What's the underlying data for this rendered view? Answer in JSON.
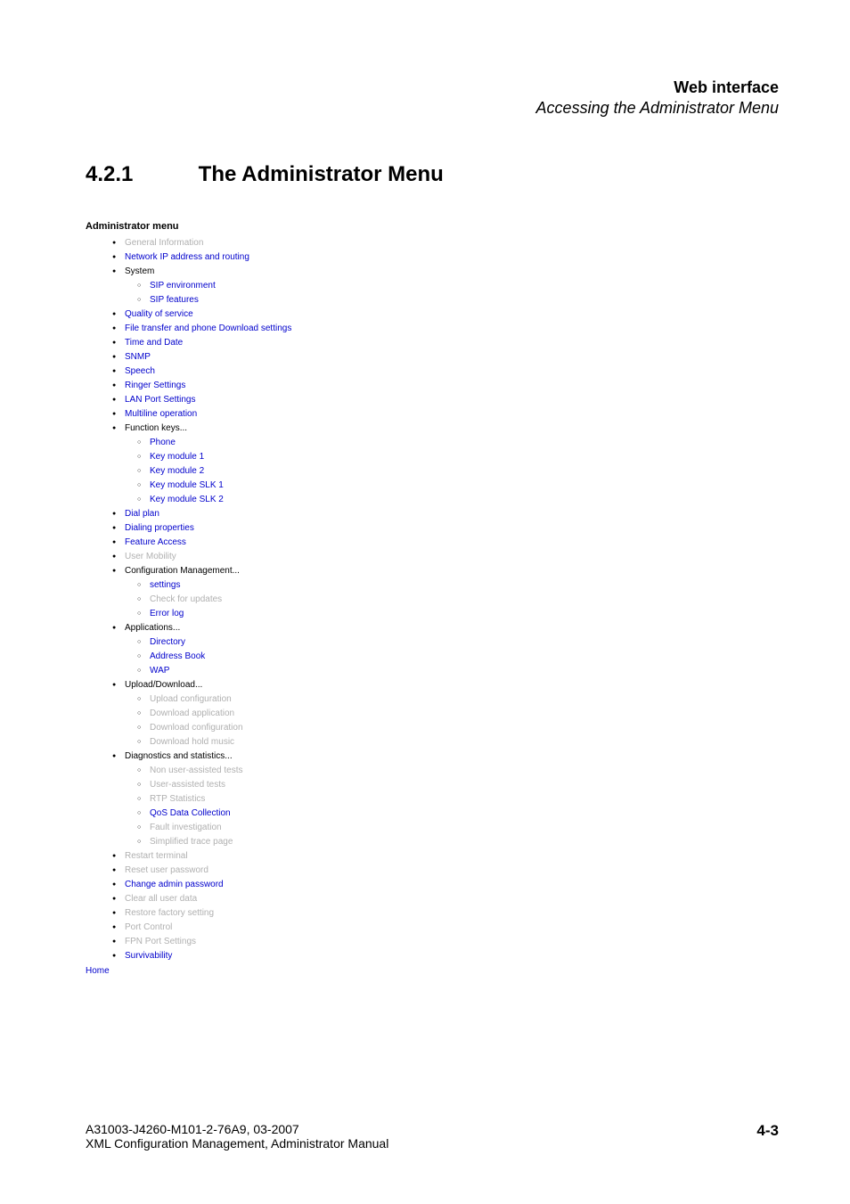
{
  "header": {
    "title_bold": "Web interface",
    "title_italic": "Accessing the Administrator Menu"
  },
  "section": {
    "number": "4.2.1",
    "title": "The Administrator Menu"
  },
  "menu": {
    "title": "Administrator menu",
    "items": [
      {
        "label": "General Information",
        "style": "muted"
      },
      {
        "label": "Network IP address and routing",
        "style": "link"
      },
      {
        "label": "System",
        "style": "plain",
        "children": [
          {
            "label": "SIP environment",
            "style": "link"
          },
          {
            "label": "SIP features",
            "style": "link"
          }
        ]
      },
      {
        "label": "Quality of service",
        "style": "link"
      },
      {
        "label": "File transfer and phone Download settings",
        "style": "link"
      },
      {
        "label": "Time and Date",
        "style": "link"
      },
      {
        "label": "SNMP",
        "style": "link"
      },
      {
        "label": "Speech",
        "style": "link"
      },
      {
        "label": "Ringer Settings",
        "style": "link"
      },
      {
        "label": "LAN Port Settings",
        "style": "link"
      },
      {
        "label": "Multiline operation",
        "style": "link"
      },
      {
        "label": "Function keys...",
        "style": "plain",
        "children": [
          {
            "label": "Phone",
            "style": "link"
          },
          {
            "label": "Key module 1",
            "style": "link"
          },
          {
            "label": "Key module 2",
            "style": "link"
          },
          {
            "label": "Key module SLK 1",
            "style": "link"
          },
          {
            "label": "Key module SLK 2",
            "style": "link"
          }
        ]
      },
      {
        "label": "Dial plan",
        "style": "link"
      },
      {
        "label": "Dialing properties",
        "style": "link"
      },
      {
        "label": "Feature Access",
        "style": "link"
      },
      {
        "label": "User Mobility",
        "style": "muted"
      },
      {
        "label": "Configuration Management...",
        "style": "plain",
        "children": [
          {
            "label": "settings",
            "style": "link"
          },
          {
            "label": "Check for updates",
            "style": "muted"
          },
          {
            "label": "Error log",
            "style": "link"
          }
        ]
      },
      {
        "label": "Applications...",
        "style": "plain",
        "children": [
          {
            "label": "Directory",
            "style": "link"
          },
          {
            "label": "Address Book",
            "style": "link"
          },
          {
            "label": "WAP",
            "style": "link"
          }
        ]
      },
      {
        "label": "Upload/Download...",
        "style": "plain",
        "children": [
          {
            "label": "Upload configuration",
            "style": "muted"
          },
          {
            "label": "Download application",
            "style": "muted"
          },
          {
            "label": "Download configuration",
            "style": "muted"
          },
          {
            "label": "Download hold music",
            "style": "muted"
          }
        ]
      },
      {
        "label": "Diagnostics and statistics...",
        "style": "plain",
        "children": [
          {
            "label": "Non user-assisted tests",
            "style": "muted"
          },
          {
            "label": "User-assisted tests",
            "style": "muted"
          },
          {
            "label": "RTP Statistics",
            "style": "muted"
          },
          {
            "label": "QoS Data Collection",
            "style": "link"
          },
          {
            "label": "Fault investigation",
            "style": "muted"
          },
          {
            "label": "Simplified trace page",
            "style": "muted"
          }
        ]
      },
      {
        "label": "Restart terminal",
        "style": "muted"
      },
      {
        "label": "Reset user password",
        "style": "muted"
      },
      {
        "label": "Change admin password",
        "style": "link"
      },
      {
        "label": "Clear all user data",
        "style": "muted"
      },
      {
        "label": "Restore factory setting",
        "style": "muted"
      },
      {
        "label": "Port Control",
        "style": "muted"
      },
      {
        "label": "FPN Port Settings",
        "style": "muted"
      },
      {
        "label": "Survivability",
        "style": "link"
      }
    ],
    "home": "Home"
  },
  "footer": {
    "line1": "A31003-J4260-M101-2-76A9, 03-2007",
    "line2": "XML Configuration Management, Administrator Manual",
    "page": "4-3"
  }
}
